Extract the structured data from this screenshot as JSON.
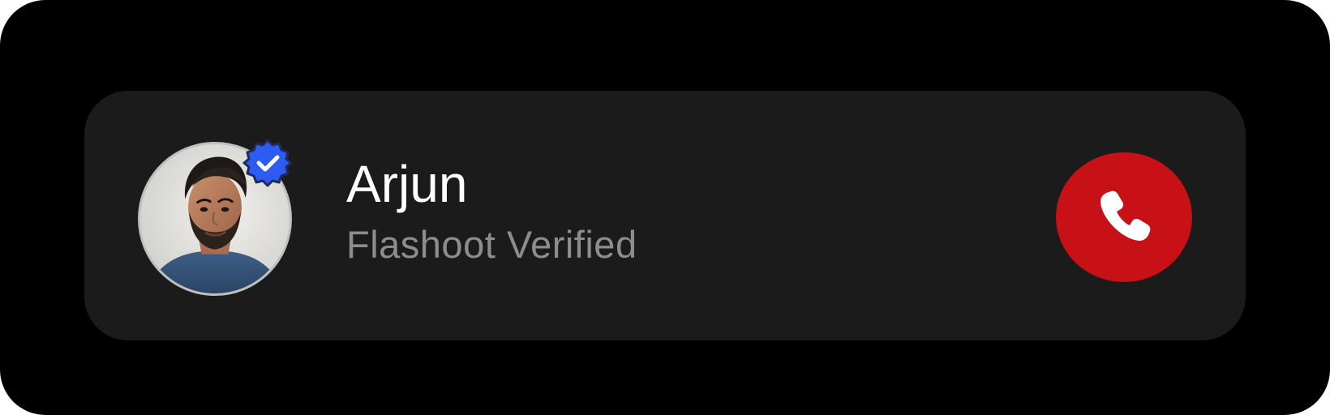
{
  "contact": {
    "name": "Arjun",
    "subtitle": "Flashoot Verified",
    "verified_badge_icon": "verified-check-badge-icon",
    "avatar_image": "profile-photo"
  },
  "actions": {
    "end_call_icon": "phone-icon"
  },
  "colors": {
    "page_background": "#000000",
    "card_background": "#1b1b1b",
    "name_text": "#ffffff",
    "subtitle_text": "#8d8d8d",
    "end_call_button": "#c81017",
    "verified_badge": "#2f5bf5",
    "verified_badge_outline": "#1f2a55"
  }
}
